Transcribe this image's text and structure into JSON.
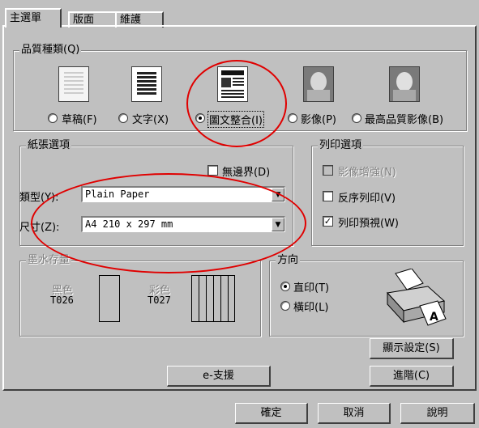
{
  "tabs": [
    {
      "label": "主選單"
    },
    {
      "label": "版面"
    },
    {
      "label": "維護"
    }
  ],
  "quality": {
    "group_title": "品質種類(Q)",
    "options": [
      {
        "label": "草稿(F)",
        "selected": false
      },
      {
        "label": "文字(X)",
        "selected": false
      },
      {
        "label": "圖文整合(I)",
        "selected": true
      },
      {
        "label": "影像(P)",
        "selected": false
      },
      {
        "label": "最高品質影像(B)",
        "selected": false
      }
    ]
  },
  "paper": {
    "group_title": "紙張選項",
    "borderless_label": "無邊界(D)",
    "type_label": "類型(Y):",
    "type_value": "Plain Paper",
    "size_label": "尺寸(Z):",
    "size_value": "A4 210 x 297 mm"
  },
  "print_options": {
    "group_title": "列印選項",
    "enhance_label": "影像增強(N)",
    "reverse_label": "反序列印(V)",
    "preview_label": "列印預視(W)",
    "preview_checked": true
  },
  "ink": {
    "group_title": "墨水存量",
    "black_label": "黑色",
    "black_code": "T026",
    "color_label": "彩色",
    "color_code": "T027"
  },
  "orientation": {
    "group_title": "方向",
    "portrait_label": "直印(T)",
    "landscape_label": "橫印(L)",
    "selected": "portrait"
  },
  "buttons": {
    "show_settings": "顯示設定(S)",
    "e_support": "e-支援",
    "advanced": "進階(C)",
    "ok": "確定",
    "cancel": "取消",
    "help": "說明"
  },
  "colors": {
    "highlight": "#e00000",
    "face": "#c0c0c0"
  }
}
